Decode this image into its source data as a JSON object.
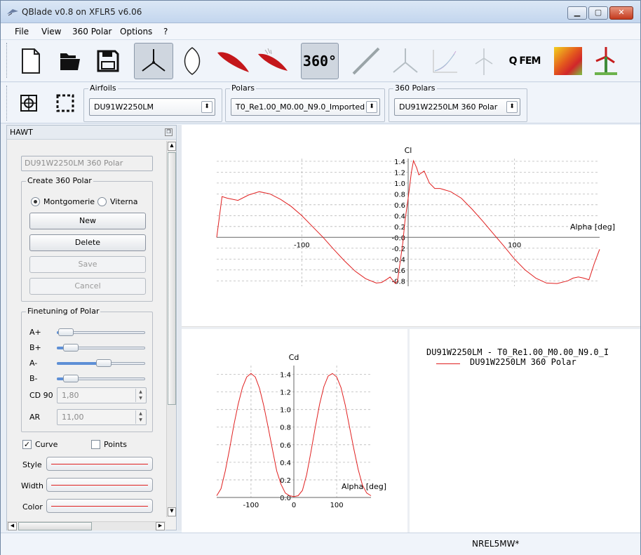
{
  "window": {
    "title": "QBlade v0.8 on XFLR5 v6.06"
  },
  "menu": {
    "file": "File",
    "view": "View",
    "polar360": "360 Polar",
    "options": "Options",
    "help": "?"
  },
  "toolbar": {
    "buttons": [
      "new-file",
      "open-folder",
      "save",
      "hawt-rotor",
      "airfoil-shape",
      "airfoil-design",
      "xfoil-analysis",
      "360-extrapolation",
      "blade-design",
      "rotor-simulation",
      "multi-parameter",
      "turbine-simulation",
      "qfem",
      "heat-map",
      "wind-turbine"
    ],
    "qfem_label": "Q FEM",
    "p360_label": "360°"
  },
  "selectors": {
    "airfoils": {
      "label": "Airfoils",
      "value": "DU91W2250LM"
    },
    "polars": {
      "label": "Polars",
      "value": "T0_Re1.00_M0.00_N9.0_Imported"
    },
    "polars360": {
      "label": "360 Polars",
      "value": "DU91W2250LM 360 Polar"
    }
  },
  "panel": {
    "title": "HAWT",
    "name_field": "DU91W2250LM 360 Polar",
    "create_group": "Create 360 Polar",
    "radio_montgomerie": "Montgomerie",
    "radio_viterna": "Viterna",
    "new": "New",
    "delete": "Delete",
    "save": "Save",
    "cancel": "Cancel",
    "finetune_group": "Finetuning of Polar",
    "sliders": [
      {
        "label": "A+",
        "value": 0.05
      },
      {
        "label": "B+",
        "value": 0.1
      },
      {
        "label": "A-",
        "value": 0.48
      },
      {
        "label": "B-",
        "value": 0.1
      }
    ],
    "cd90_label": "CD 90",
    "cd90_value": "1,80",
    "ar_label": "AR",
    "ar_value": "11,00",
    "curve_label": "Curve",
    "curve_checked": true,
    "points_label": "Points",
    "points_checked": false,
    "style_label": "Style",
    "width_label": "Width",
    "color_label": "Color",
    "curve_color": "#e02020"
  },
  "legend": {
    "title": "DU91W2250LM - T0_Re1.00_M0.00_N9.0_I",
    "entry": "DU91W2250LM 360 Polar"
  },
  "status": {
    "project": "NREL5MW*"
  },
  "chart_data": [
    {
      "type": "line",
      "ylabel": "Cl",
      "xlabel": "Alpha [deg]",
      "xlim": [
        -180,
        180
      ],
      "ylim": [
        -0.9,
        1.45
      ],
      "x_ticks": [
        "-100",
        "100"
      ],
      "y_ticks": [
        "1.4",
        "1.2",
        "1.0",
        "0.8",
        "0.6",
        "0.4",
        "0.2",
        "-0.0",
        "-0.2",
        "-0.4",
        "-0.6",
        "-0.8"
      ],
      "grid": true,
      "series": [
        {
          "name": "DU91W2250LM 360 Polar",
          "color": "#e02020",
          "x": [
            -180,
            -175,
            -170,
            -160,
            -150,
            -140,
            -130,
            -120,
            -110,
            -100,
            -90,
            -80,
            -70,
            -60,
            -50,
            -40,
            -30,
            -25,
            -20,
            -17,
            -15,
            -12,
            -10,
            -8,
            -5,
            -3,
            0,
            3,
            5,
            8,
            10,
            12,
            15,
            20,
            25,
            30,
            40,
            50,
            60,
            70,
            80,
            90,
            100,
            110,
            120,
            130,
            140,
            150,
            155,
            160,
            165,
            170,
            175,
            180
          ],
          "y": [
            0.0,
            0.75,
            0.72,
            0.68,
            0.78,
            0.84,
            0.8,
            0.7,
            0.57,
            0.4,
            0.2,
            0.0,
            -0.22,
            -0.43,
            -0.62,
            -0.76,
            -0.84,
            -0.83,
            -0.77,
            -0.73,
            -0.78,
            -0.85,
            -0.8,
            -0.52,
            -0.1,
            0.3,
            0.72,
            1.2,
            1.41,
            1.28,
            1.15,
            1.18,
            1.22,
            1.0,
            0.9,
            0.9,
            0.84,
            0.72,
            0.52,
            0.3,
            0.07,
            -0.16,
            -0.4,
            -0.6,
            -0.75,
            -0.84,
            -0.85,
            -0.8,
            -0.75,
            -0.73,
            -0.75,
            -0.78,
            -0.48,
            -0.22
          ]
        }
      ]
    },
    {
      "type": "line",
      "ylabel": "Cd",
      "xlabel": "Alpha [deg]",
      "xlim": [
        -180,
        180
      ],
      "ylim": [
        0.0,
        1.5
      ],
      "x_ticks": [
        "-100",
        "0",
        "100"
      ],
      "y_ticks": [
        "1.4",
        "1.2",
        "1.0",
        "0.8",
        "0.6",
        "0.4",
        "0.2",
        "0.0"
      ],
      "grid": true,
      "series": [
        {
          "name": "DU91W2250LM 360 Polar",
          "color": "#e02020",
          "x": [
            -180,
            -170,
            -160,
            -150,
            -140,
            -130,
            -120,
            -110,
            -100,
            -90,
            -80,
            -70,
            -60,
            -50,
            -40,
            -30,
            -20,
            -10,
            0,
            10,
            20,
            30,
            40,
            50,
            60,
            70,
            80,
            90,
            100,
            110,
            120,
            130,
            140,
            150,
            160,
            170,
            180
          ],
          "y": [
            0.02,
            0.1,
            0.3,
            0.55,
            0.82,
            1.06,
            1.25,
            1.37,
            1.41,
            1.37,
            1.24,
            1.04,
            0.8,
            0.55,
            0.3,
            0.15,
            0.05,
            0.02,
            0.01,
            0.02,
            0.08,
            0.26,
            0.52,
            0.8,
            1.06,
            1.26,
            1.38,
            1.41,
            1.37,
            1.25,
            1.05,
            0.8,
            0.55,
            0.32,
            0.14,
            0.05,
            0.02
          ]
        }
      ]
    }
  ]
}
